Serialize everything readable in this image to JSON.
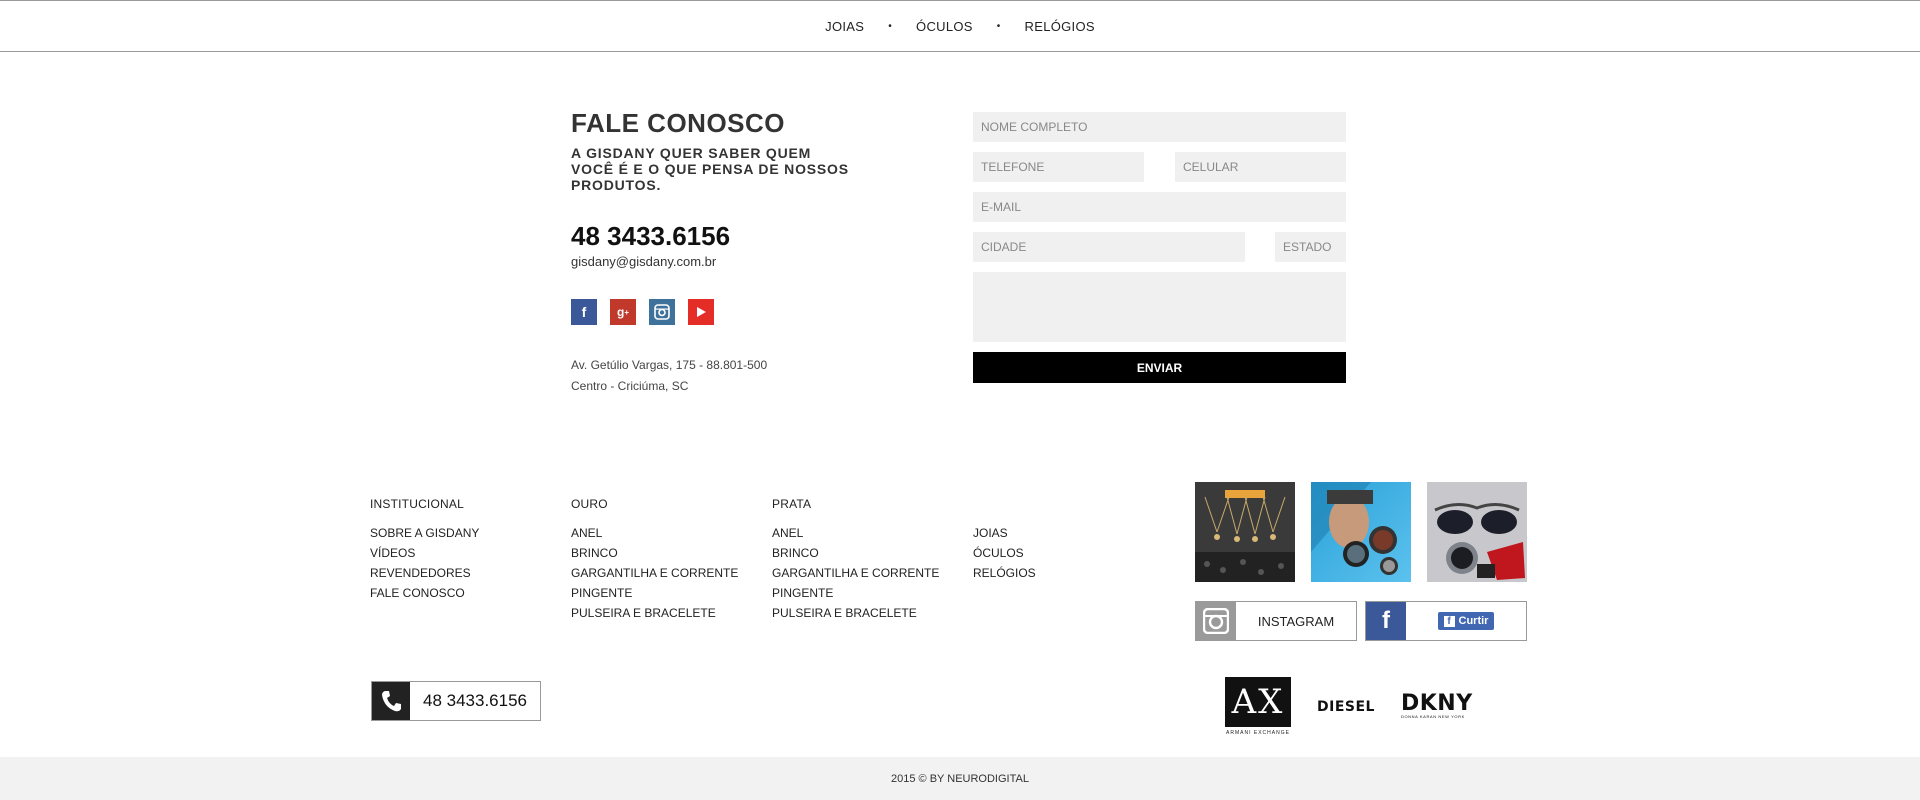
{
  "nav": {
    "items": [
      "JOIAS",
      "ÓCULOS",
      "RELÓGIOS"
    ]
  },
  "contact": {
    "title": "FALE CONOSCO",
    "subtitle": "A GISDANY QUER SABER QUEM VOCÊ É E O QUE PENSA DE NOSSOS PRODUTOS.",
    "phone": "48 3433.6156",
    "email": "gisdany@gisdany.com.br",
    "address_line1": "Av. Getúlio Vargas, 175 - 88.801-500",
    "address_line2": "Centro - Criciúma, SC",
    "social_icons": [
      "facebook-icon",
      "google-plus-icon",
      "instagram-icon",
      "youtube-icon"
    ]
  },
  "form": {
    "name_placeholder": "NOME COMPLETO",
    "phone_placeholder": "TELEFONE",
    "mobile_placeholder": "CELULAR",
    "email_placeholder": "E-MAIL",
    "city_placeholder": "CIDADE",
    "state_placeholder": "ESTADO",
    "message_placeholder": "",
    "submit_label": "ENVIAR"
  },
  "footer": {
    "institucional": {
      "heading": "INSTITUCIONAL",
      "links": [
        "SOBRE A GISDANY",
        "VÍDEOS",
        "REVENDEDORES",
        "FALE CONOSCO"
      ]
    },
    "ouro": {
      "heading": "OURO",
      "links": [
        "ANEL",
        "BRINCO",
        "GARGANTILHA E CORRENTE",
        "PINGENTE",
        "PULSEIRA E BRACELETE"
      ]
    },
    "prata": {
      "heading": "PRATA",
      "links": [
        "ANEL",
        "BRINCO",
        "GARGANTILHA E CORRENTE",
        "PINGENTE",
        "PULSEIRA E BRACELETE"
      ]
    },
    "categorias": {
      "links": [
        "JOIAS",
        "ÓCULOS",
        "RELÓGIOS"
      ]
    },
    "instagram_label": "INSTAGRAM",
    "facebook_like_label": "Curtir",
    "phone": "48 3433.6156",
    "brands": {
      "ax": "AX",
      "ax_sub": "ARMANI EXCHANGE",
      "diesel": "DIESEL",
      "dkny": "DKNY",
      "dkny_sub": "DONNA KARAN NEW YORK"
    },
    "copyright": "2015 © BY NEURODIGITAL"
  },
  "colors": {
    "facebook": "#3b5998",
    "google_plus": "#c0392b",
    "instagram": "#3f729b",
    "youtube": "#e52d27",
    "button": "#000000",
    "field": "#f0f0f0"
  }
}
